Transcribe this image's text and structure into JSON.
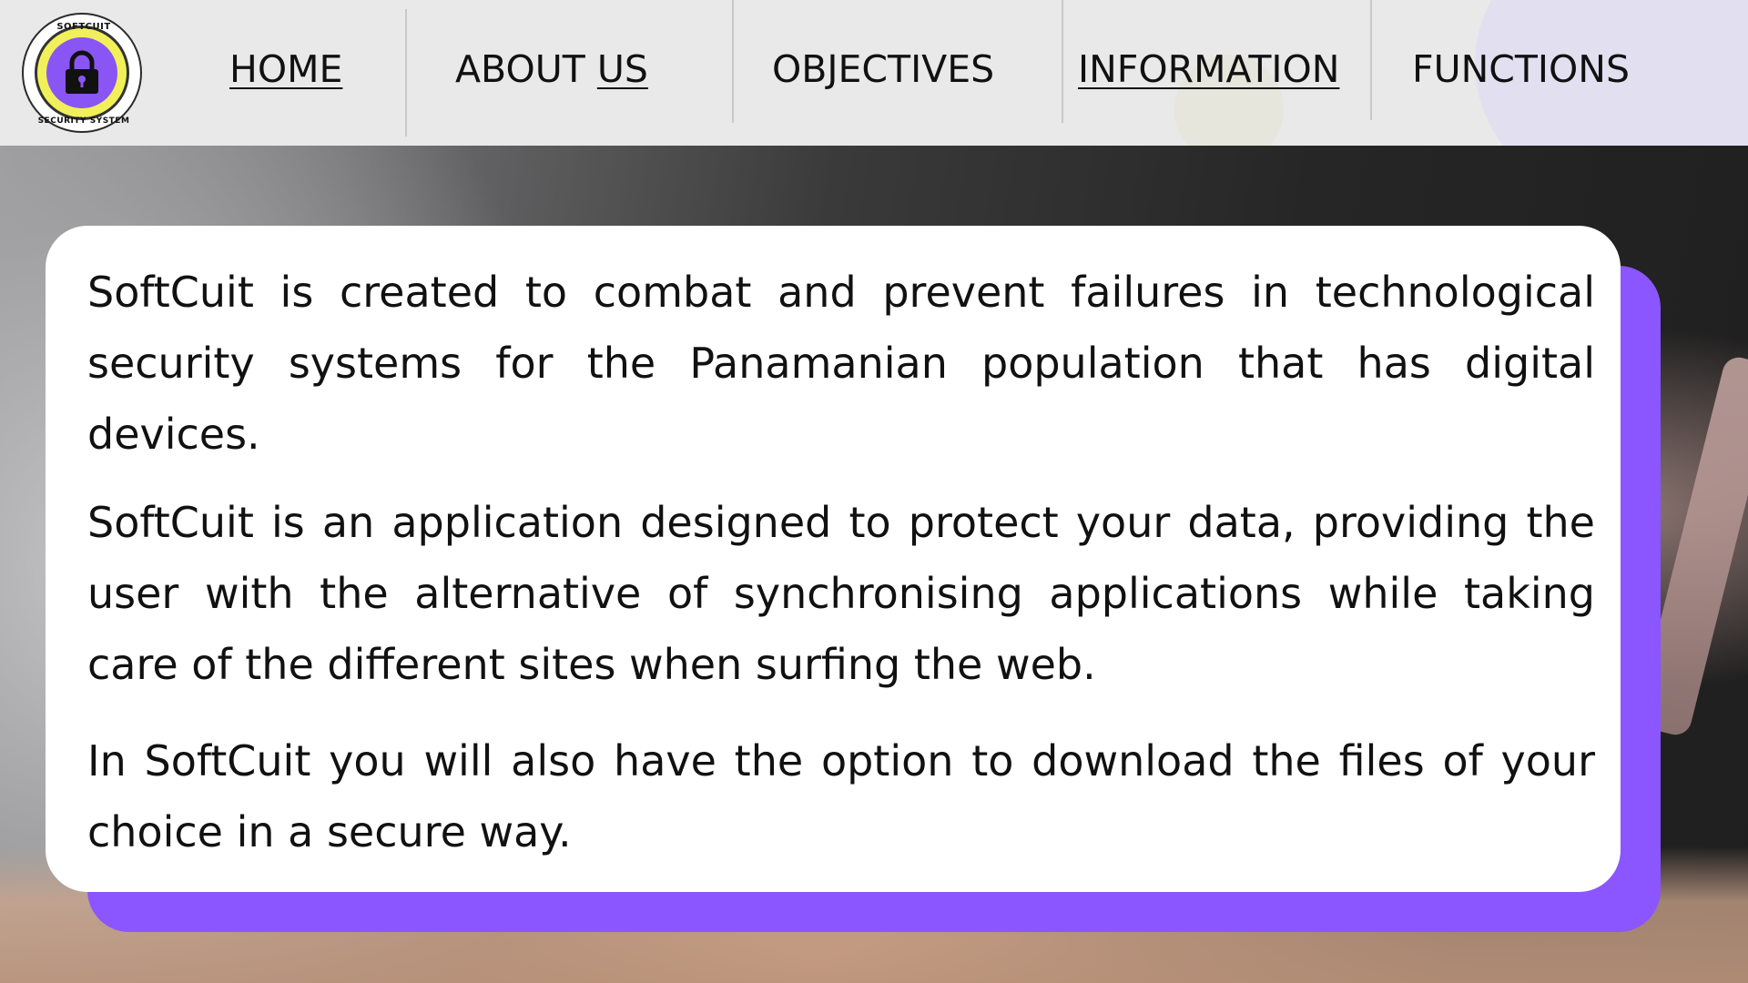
{
  "brand": {
    "logo_top_text": "SOFTCUIT",
    "logo_bottom_text": "SECURITY SYSTEM",
    "logo_colors": {
      "ring": "#f2f05a",
      "inner": "#8a55f5"
    }
  },
  "nav": {
    "items": [
      {
        "label": "HOME"
      },
      {
        "label_part1": "ABOUT ",
        "label_part2": "US"
      },
      {
        "label": "OBJECTIVES"
      },
      {
        "label": "INFORMATION"
      },
      {
        "label": "FUNCTIONS"
      }
    ]
  },
  "content": {
    "paragraphs": [
      "SoftCuit is created to combat and prevent failures in technological security systems for the Panamanian population that has digital devices.",
      "SoftCuit is an application designed to protect your data, providing the user with the alternative of synchronising applications while taking care of the different sites when surfing the web.",
      "In SoftCuit you will also have the option to download the files of your choice in a secure way."
    ]
  },
  "colors": {
    "accent": "#8b55ff",
    "header_bg": "#e9e9e9",
    "card_bg": "#ffffff"
  }
}
